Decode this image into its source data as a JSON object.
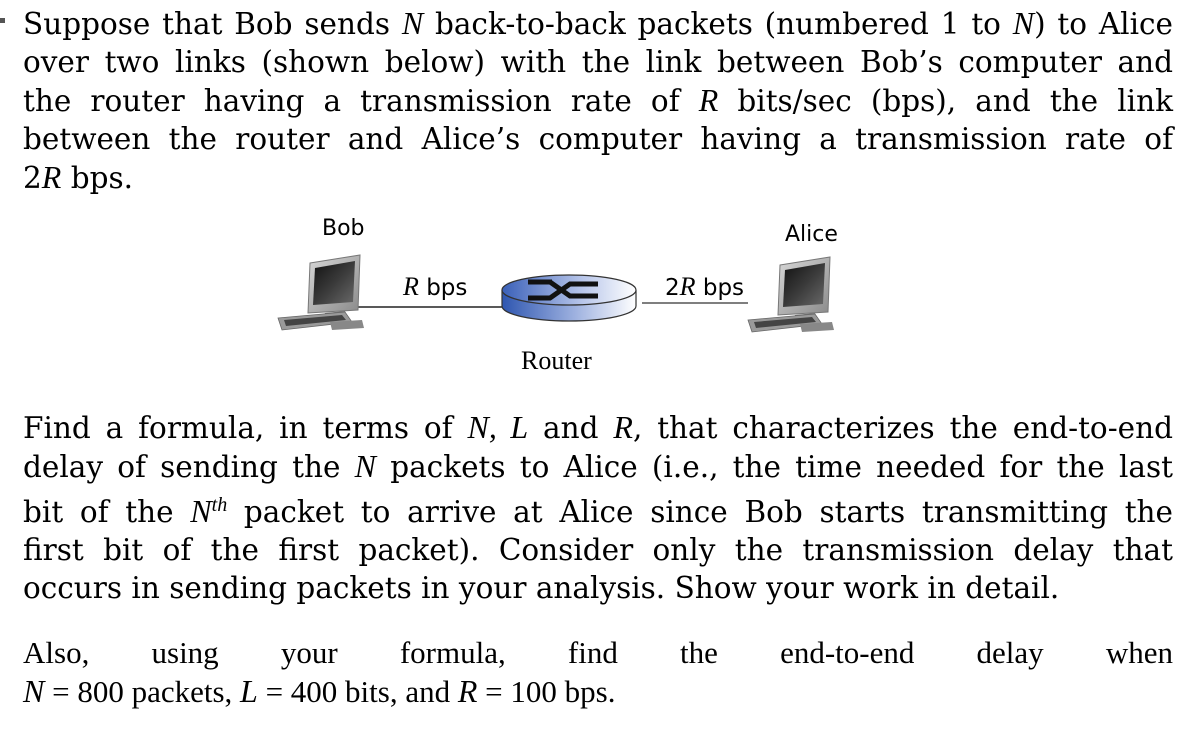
{
  "problem": {
    "paragraph1": {
      "lines": [
        [
          "Suppose that Bob sends ",
          "N",
          " back-to-back packets (numbered 1 to ",
          "N",
          ") to Alice"
        ],
        [
          "over two links (shown below) with the link between Bob’s computer and"
        ],
        [
          "the router having a transmission rate of ",
          "R",
          " bits/sec (bps), and the link"
        ],
        [
          "between the router and Alice’s computer having a transmission rate of"
        ],
        [
          "2",
          "R",
          " bps."
        ]
      ]
    },
    "diagram": {
      "bob_label": "Bob",
      "alice_label": "Alice",
      "router_label": "Router",
      "link1_var": "R",
      "link1_unit": " bps",
      "link2_prefix": "2",
      "link2_var": "R",
      "link2_unit": " bps",
      "router_color": "#3a5fb8"
    },
    "paragraph2": {
      "lines": [
        [
          "Find a formula, in terms of ",
          "N, L",
          " and ",
          "R",
          ", that characterizes the end-to-end"
        ],
        [
          "delay of sending the ",
          "N",
          " packets to Alice (i.e., the time needed for the last"
        ],
        [
          "bit of the ",
          "N",
          "th",
          " packet to arrive at Alice since Bob starts transmitting the"
        ],
        [
          "first bit of the first packet). Consider only the transmission delay that"
        ],
        [
          "occurs in sending packets in your analysis. Show your work in detail."
        ]
      ]
    },
    "paragraph3": {
      "line1": [
        "Also,",
        "using",
        "your",
        "formula,",
        "find",
        "the",
        "end-to-end",
        "delay",
        "when"
      ],
      "line2": {
        "N_var": "N",
        "N_val": " = 800 packets, ",
        "L_var": "L",
        "L_val": " = 400 bits, and ",
        "R_var": "R",
        "R_val": " = 100 bps."
      }
    }
  }
}
